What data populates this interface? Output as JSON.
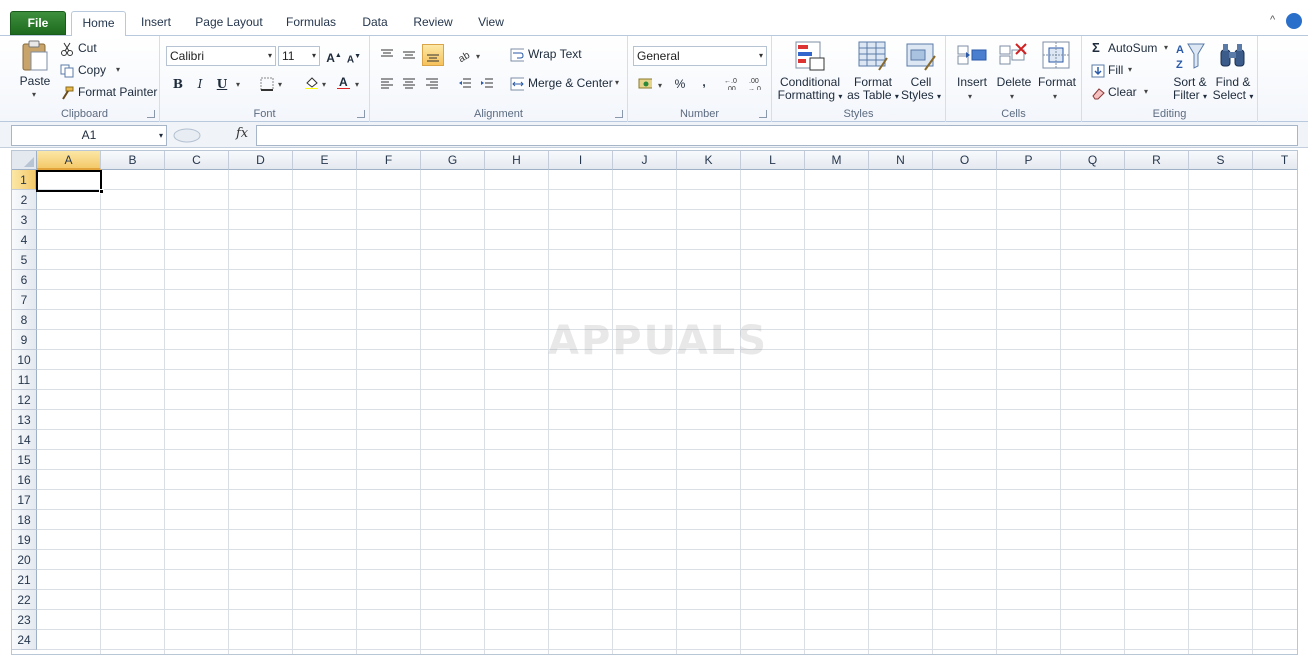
{
  "tabs": [
    {
      "label": "File"
    },
    {
      "label": "Home"
    },
    {
      "label": "Insert"
    },
    {
      "label": "Page Layout"
    },
    {
      "label": "Formulas"
    },
    {
      "label": "Data"
    },
    {
      "label": "Review"
    },
    {
      "label": "View"
    }
  ],
  "clipboard": {
    "paste": "Paste",
    "cut": "Cut",
    "copy": "Copy",
    "format_painter": "Format Painter",
    "label": "Clipboard"
  },
  "font": {
    "name": "Calibri",
    "size": "11",
    "bold": "B",
    "italic": "I",
    "underline": "U",
    "label": "Font"
  },
  "alignment": {
    "wrap_text": "Wrap Text",
    "merge_center": "Merge & Center",
    "label": "Alignment"
  },
  "number": {
    "format": "General",
    "percent": "%",
    "comma": ",",
    "label": "Number"
  },
  "styles": {
    "conditional_line1": "Conditional",
    "conditional_line2": "Formatting",
    "format_table_line1": "Format",
    "format_table_line2": "as Table",
    "cell_styles_line1": "Cell",
    "cell_styles_line2": "Styles",
    "label": "Styles"
  },
  "cells": {
    "insert": "Insert",
    "delete": "Delete",
    "format": "Format",
    "label": "Cells"
  },
  "editing": {
    "autosum": "AutoSum",
    "fill": "Fill",
    "clear": "Clear",
    "sort_line1": "Sort &",
    "sort_line2": "Filter",
    "find_line1": "Find &",
    "find_line2": "Select",
    "label": "Editing"
  },
  "formula_bar": {
    "name_box": "A1",
    "fx": "fx",
    "value": ""
  },
  "columns": [
    "A",
    "B",
    "C",
    "D",
    "E",
    "F",
    "G",
    "H",
    "I",
    "J",
    "K",
    "L",
    "M",
    "N",
    "O",
    "P",
    "Q",
    "R",
    "S",
    "T"
  ],
  "rows": [
    "1",
    "2",
    "3",
    "4",
    "5",
    "6",
    "7",
    "8",
    "9",
    "10",
    "11",
    "12",
    "13",
    "14",
    "15",
    "16",
    "17",
    "18",
    "19",
    "20",
    "21",
    "22",
    "23",
    "24"
  ],
  "selected_cell": "A1",
  "watermark": "APPUALS",
  "colors": {
    "file_tab": "#1e6a1e",
    "header_selected": "#f4c96a",
    "ribbon_border": "#b8c9dd"
  }
}
